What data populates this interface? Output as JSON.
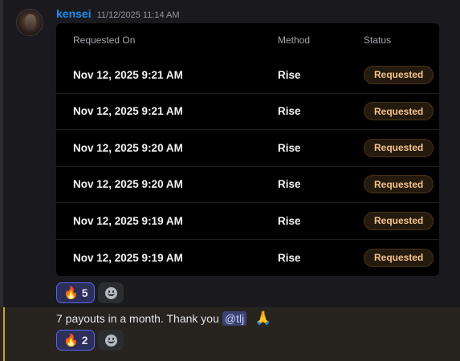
{
  "message": {
    "username": "kensei",
    "timestamp": "11/12/2025 11:14 AM",
    "table": {
      "headers": [
        "Requested On",
        "Method",
        "Status"
      ],
      "rows": [
        {
          "date": "Nov 12, 2025 9:21 AM",
          "method": "Rise",
          "status": "Requested"
        },
        {
          "date": "Nov 12, 2025 9:21 AM",
          "method": "Rise",
          "status": "Requested"
        },
        {
          "date": "Nov 12, 2025 9:20 AM",
          "method": "Rise",
          "status": "Requested"
        },
        {
          "date": "Nov 12, 2025 9:20 AM",
          "method": "Rise",
          "status": "Requested"
        },
        {
          "date": "Nov 12, 2025 9:19 AM",
          "method": "Rise",
          "status": "Requested"
        },
        {
          "date": "Nov 12, 2025 9:19 AM",
          "method": "Rise",
          "status": "Requested"
        }
      ]
    },
    "reaction": {
      "emoji": "🔥",
      "count": "5"
    }
  },
  "message2": {
    "text": "7 payouts in a month. Thank you",
    "mention": "@tlj",
    "emoji": "🙏",
    "reaction": {
      "emoji": "🔥",
      "count": "2"
    }
  },
  "colors": {
    "username": "#1e8cf3",
    "badge_text": "#f4c48c",
    "reaction_border": "#5865f2",
    "highlight_bar": "#c9a227"
  },
  "icons": [
    "avatar",
    "fire-emoji",
    "add-reaction-icon",
    "pray-emoji"
  ]
}
